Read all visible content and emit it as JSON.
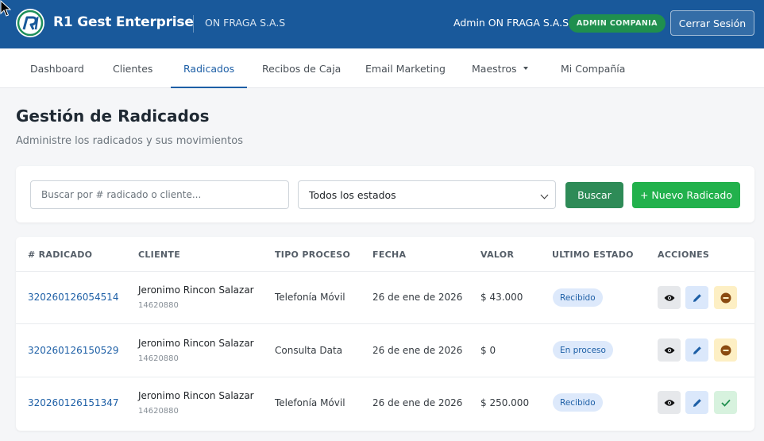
{
  "header": {
    "brand": "R1 Gest Enterprise",
    "company": "ON FRAGA S.A.S",
    "user": "Admin ON FRAGA S.A.S",
    "role_badge": "ADMIN COMPANIA",
    "logout_label": "Cerrar Sesión"
  },
  "nav": {
    "items": [
      {
        "label": "Dashboard"
      },
      {
        "label": "Clientes"
      },
      {
        "label": "Radicados"
      },
      {
        "label": "Recibos de Caja"
      },
      {
        "label": "Email Marketing"
      },
      {
        "label": "Maestros"
      },
      {
        "label": "Mi Compañía"
      }
    ],
    "active": "Radicados"
  },
  "page": {
    "title": "Gestión de Radicados",
    "subtitle": "Administre los radicados y sus movimientos"
  },
  "filters": {
    "search_placeholder": "Buscar por # radicado o cliente...",
    "search_value": "",
    "status_selected": "Todos los estados",
    "search_button": "Buscar",
    "new_button": "+ Nuevo Radicado"
  },
  "table": {
    "headers": [
      "# RADICADO",
      "CLIENTE",
      "TIPO PROCESO",
      "FECHA",
      "VALOR",
      "ULTIMO ESTADO",
      "ACCIONES"
    ],
    "rows": [
      {
        "radicado": "320260126054514",
        "cliente": "Jeronimo Rincon Salazar",
        "documento": "14620880",
        "tipo_proceso": "Telefonía Móvil",
        "fecha": "26 de ene de 2026",
        "valor": "$ 43.000",
        "estado": "Recibido",
        "third_action": "minus-circle-icon"
      },
      {
        "radicado": "320260126150529",
        "cliente": "Jeronimo Rincon Salazar",
        "documento": "14620880",
        "tipo_proceso": "Consulta Data",
        "fecha": "26 de ene de 2026",
        "valor": "$ 0",
        "estado": "En proceso",
        "third_action": "minus-circle-icon"
      },
      {
        "radicado": "320260126151347",
        "cliente": "Jeronimo Rincon Salazar",
        "documento": "14620880",
        "tipo_proceso": "Telefonía Móvil",
        "fecha": "26 de ene de 2026",
        "valor": "$ 250.000",
        "estado": "Recibido",
        "third_action": "check-icon"
      }
    ]
  },
  "colors": {
    "header_bg": "#19599b",
    "accent": "#1d5fa6",
    "search_button": "#2e8b57",
    "new_button": "#22b14c",
    "role_badge": "#1f8f4e"
  }
}
